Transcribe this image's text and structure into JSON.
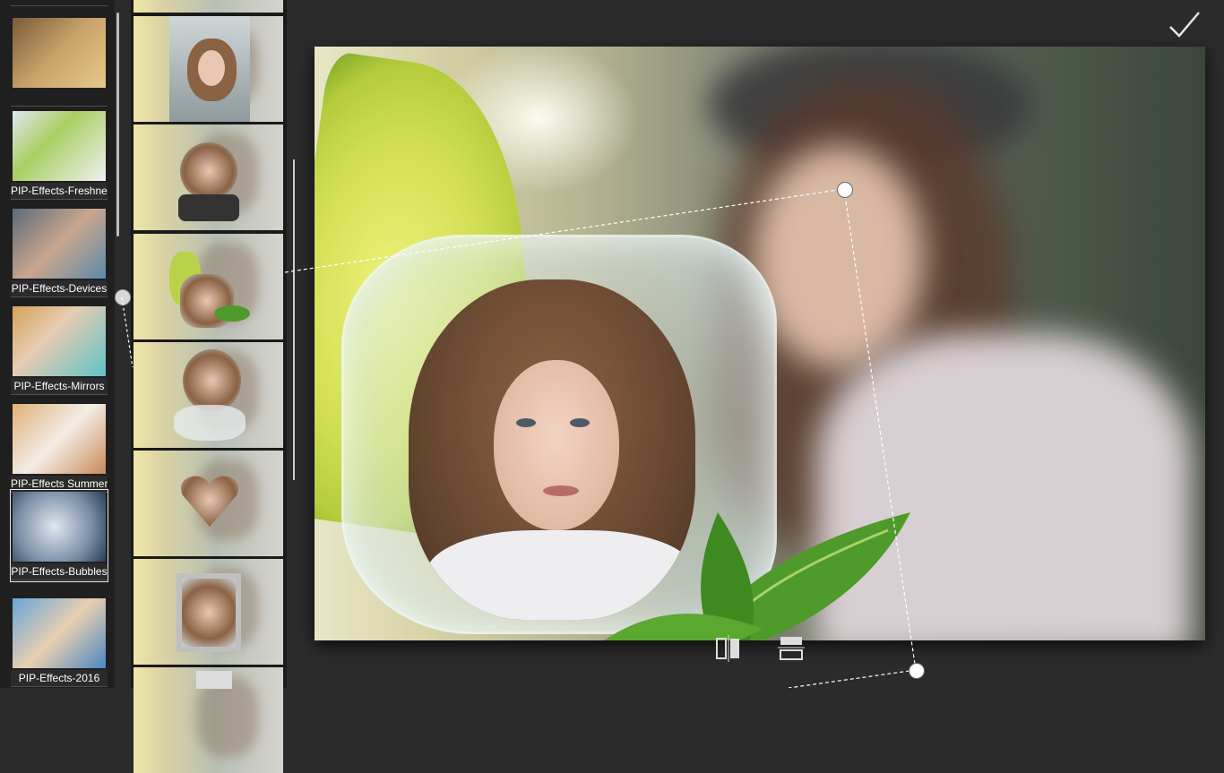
{
  "categories": [
    {
      "label": "",
      "selected": false
    },
    {
      "label": "PIP-Effects-Freshness",
      "selected": false
    },
    {
      "label": "PIP-Effects-Devices",
      "selected": false
    },
    {
      "label": "PIP-Effects-Mirrors",
      "selected": false
    },
    {
      "label": "PIP-Effects Summer",
      "selected": false
    },
    {
      "label": "PIP-Effects-Bubbles",
      "selected": true
    },
    {
      "label": "PIP-Effects-2016",
      "selected": false
    }
  ],
  "frames": [
    {
      "name": "ice-shard"
    },
    {
      "name": "snow-globe"
    },
    {
      "name": "lime-ice"
    },
    {
      "name": "ice-splash"
    },
    {
      "name": "ice-heart"
    },
    {
      "name": "glass-square"
    },
    {
      "name": "partial"
    }
  ],
  "toolbar": {
    "flip_horizontal_icon": "flip-horizontal-icon",
    "flip_vertical_icon": "flip-vertical-icon",
    "apply_icon": "checkmark-icon"
  },
  "colors": {
    "background": "#2b2b2b",
    "panel": "#1f1f1f",
    "handle": "#ffffff"
  }
}
